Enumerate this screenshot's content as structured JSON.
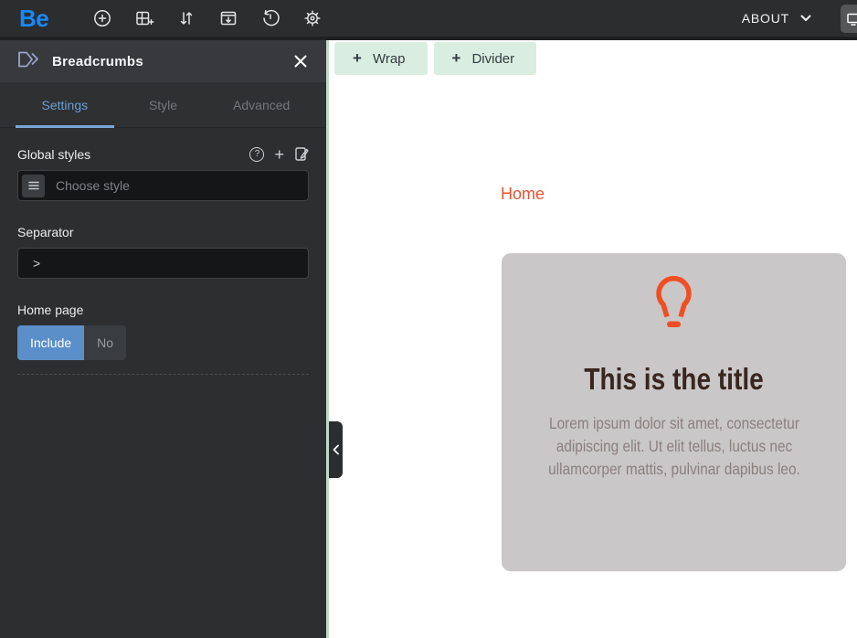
{
  "topbar": {
    "logo": "Be",
    "about_label": "ABOUT"
  },
  "panel": {
    "title": "Breadcrumbs",
    "tabs": [
      {
        "label": "Settings"
      },
      {
        "label": "Style"
      },
      {
        "label": "Advanced"
      }
    ],
    "global_styles": {
      "label": "Global styles",
      "placeholder": "Choose style",
      "help_glyph": "?",
      "add_glyph": "+"
    },
    "separator": {
      "label": "Separator",
      "value": ">"
    },
    "home_page": {
      "label": "Home page",
      "include_label": "Include",
      "no_label": "No"
    }
  },
  "canvas": {
    "plus_glyph": "+",
    "wrap_label": "Wrap",
    "divider_label": "Divider",
    "breadcrumb_home": "Home",
    "card": {
      "title": "This is the title",
      "body": "Lorem ipsum dolor sit amet, consectetur adipiscing elit. Ut elit tellus, luctus nec ullamcorper mattis, pulvinar dapibus leo."
    }
  },
  "colors": {
    "topbar_bg": "#2b2d2f",
    "sidebar_bg": "#2c2e30",
    "logo_blue": "#1689fb",
    "accent_blue": "#5b8fc9",
    "tab_active_blue": "#6d9fd4",
    "mint_button_bg": "#d9eee0",
    "mint_divider": "#bfdbc8",
    "bulb_orange": "#f04e23",
    "link_orange": "#e5532f",
    "card_bg": "#c9c7c7",
    "card_title_brown": "#3a2620",
    "card_body_gray": "#8b7f80"
  }
}
